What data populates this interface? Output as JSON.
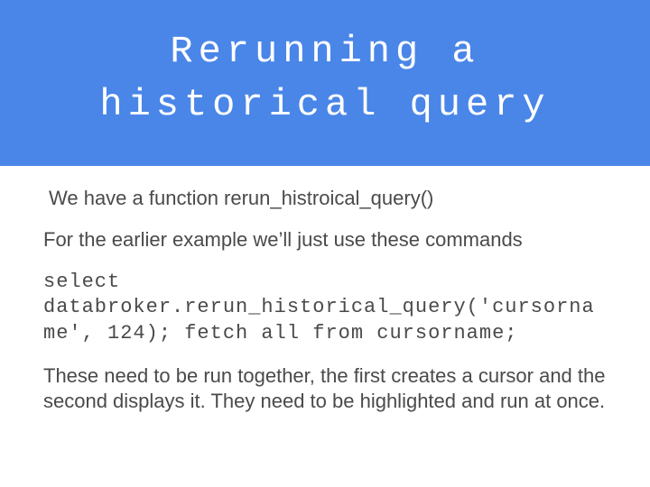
{
  "title": "Rerunning a historical query",
  "body": {
    "intro": "We have a function rerun_histroical_query()",
    "example_lead": "For the earlier example we’ll just use these commands",
    "code": "select databroker.rerun_historical_query('cursorname', 124); fetch all from cursorname;",
    "note": "These need to be run together, the first creates a cursor and the second displays it. They need to be highlighted and run at once."
  },
  "colors": {
    "title_band": "#4a86e8",
    "title_text": "#ffffff",
    "body_text": "#4a4a4a"
  }
}
